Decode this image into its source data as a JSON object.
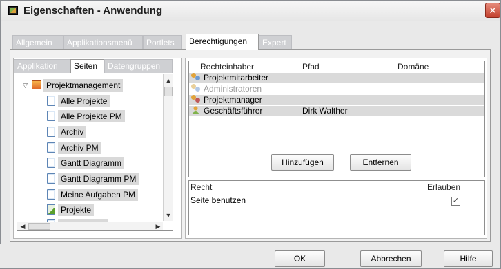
{
  "window": {
    "title": "Eigenschaften - Anwendung",
    "close_glyph": "✕"
  },
  "tabs": [
    "Allgemein",
    "Applikationsmenü",
    "Portlets",
    "Berechtigungen",
    "Expert"
  ],
  "left_tabs": [
    "Applikation",
    "Seiten",
    "Datengruppen"
  ],
  "tree": {
    "root": "Projektmanagement",
    "items": [
      "Alle Projekte",
      "Alle Projekte PM",
      "Archiv",
      "Archiv PM",
      "Gantt Diagramm",
      "Gantt Diagramm PM",
      "Meine Aufgaben PM",
      "Projekte",
      "Projekte GF"
    ]
  },
  "grid": {
    "headers": [
      "Rechteinhaber",
      "Pfad",
      "Domäne"
    ],
    "rows": [
      {
        "name": "Projektmitarbeiter",
        "path": "",
        "domain": ""
      },
      {
        "name": "Administratoren",
        "path": "",
        "domain": ""
      },
      {
        "name": "Projektmanager",
        "path": "",
        "domain": ""
      },
      {
        "name": "Geschäftsführer",
        "path": "Dirk Walther",
        "domain": ""
      }
    ]
  },
  "buttons": {
    "add_prefix": "",
    "add_mnemonic": "H",
    "add_rest": "inzufügen",
    "remove_prefix": "",
    "remove_mnemonic": "E",
    "remove_rest": "ntfernen",
    "ok": "OK",
    "cancel": "Abbrechen",
    "help": "Hilfe"
  },
  "permissions": {
    "headers": [
      "Recht",
      "Erlauben"
    ],
    "rows": [
      {
        "right": "Seite benutzen",
        "allowed_glyph": "✓"
      }
    ]
  },
  "colors": {
    "accent_red": "#c3412e",
    "tab_inactive": "#cfd0d3",
    "row_shade": "#dadada"
  }
}
